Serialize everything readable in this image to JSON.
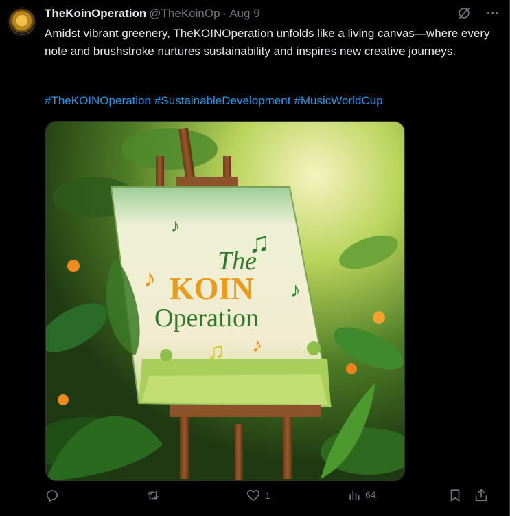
{
  "tweet": {
    "display_name": "TheKoinOperation",
    "handle": "@TheKoinOp",
    "separator": "·",
    "date": "Aug 9",
    "text": "Amidst vibrant greenery, TheKOINOperation unfolds like a living canvas—where every note and brushstroke nurtures sustainability and inspires new creative journeys.",
    "hashtags": [
      "#TheKOINOperation",
      "#SustainableDevelopment",
      "#MusicWorldCup"
    ]
  },
  "media": {
    "painting_line1": "The",
    "painting_line2": "KOIN",
    "painting_line3": "Operation"
  },
  "actions": {
    "reply_count": "",
    "retweet_count": "",
    "like_count": "1",
    "views_count": "64"
  },
  "icons": {
    "header": [
      "grok-icon",
      "more-icon"
    ],
    "actions": [
      "reply-icon",
      "retweet-icon",
      "like-icon",
      "views-icon",
      "bookmark-icon",
      "share-icon"
    ]
  },
  "colors": {
    "background": "#000000",
    "text": "#e7e9ea",
    "muted": "#71767b",
    "link": "#1d9bf0"
  }
}
